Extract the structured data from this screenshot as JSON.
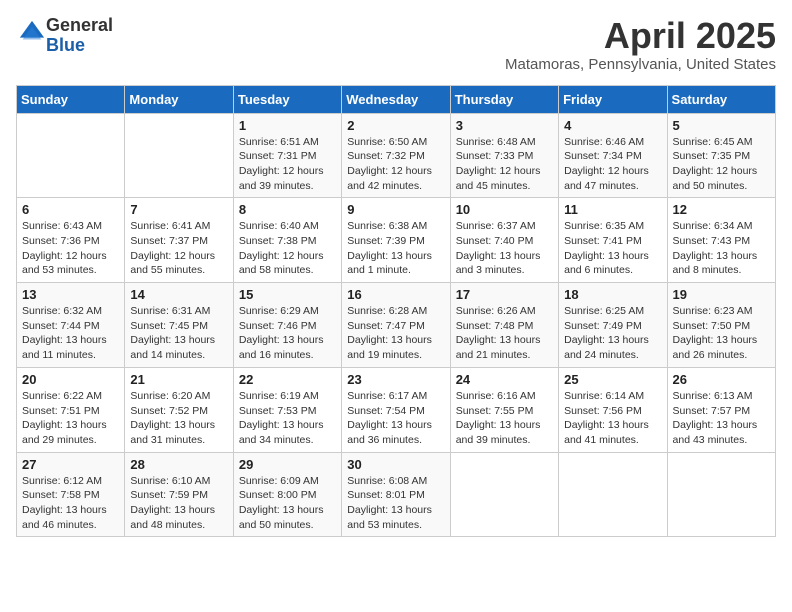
{
  "logo": {
    "general": "General",
    "blue": "Blue"
  },
  "title": "April 2025",
  "location": "Matamoras, Pennsylvania, United States",
  "days_header": [
    "Sunday",
    "Monday",
    "Tuesday",
    "Wednesday",
    "Thursday",
    "Friday",
    "Saturday"
  ],
  "weeks": [
    [
      {
        "day": "",
        "detail": ""
      },
      {
        "day": "",
        "detail": ""
      },
      {
        "day": "1",
        "detail": "Sunrise: 6:51 AM\nSunset: 7:31 PM\nDaylight: 12 hours\nand 39 minutes."
      },
      {
        "day": "2",
        "detail": "Sunrise: 6:50 AM\nSunset: 7:32 PM\nDaylight: 12 hours\nand 42 minutes."
      },
      {
        "day": "3",
        "detail": "Sunrise: 6:48 AM\nSunset: 7:33 PM\nDaylight: 12 hours\nand 45 minutes."
      },
      {
        "day": "4",
        "detail": "Sunrise: 6:46 AM\nSunset: 7:34 PM\nDaylight: 12 hours\nand 47 minutes."
      },
      {
        "day": "5",
        "detail": "Sunrise: 6:45 AM\nSunset: 7:35 PM\nDaylight: 12 hours\nand 50 minutes."
      }
    ],
    [
      {
        "day": "6",
        "detail": "Sunrise: 6:43 AM\nSunset: 7:36 PM\nDaylight: 12 hours\nand 53 minutes."
      },
      {
        "day": "7",
        "detail": "Sunrise: 6:41 AM\nSunset: 7:37 PM\nDaylight: 12 hours\nand 55 minutes."
      },
      {
        "day": "8",
        "detail": "Sunrise: 6:40 AM\nSunset: 7:38 PM\nDaylight: 12 hours\nand 58 minutes."
      },
      {
        "day": "9",
        "detail": "Sunrise: 6:38 AM\nSunset: 7:39 PM\nDaylight: 13 hours\nand 1 minute."
      },
      {
        "day": "10",
        "detail": "Sunrise: 6:37 AM\nSunset: 7:40 PM\nDaylight: 13 hours\nand 3 minutes."
      },
      {
        "day": "11",
        "detail": "Sunrise: 6:35 AM\nSunset: 7:41 PM\nDaylight: 13 hours\nand 6 minutes."
      },
      {
        "day": "12",
        "detail": "Sunrise: 6:34 AM\nSunset: 7:43 PM\nDaylight: 13 hours\nand 8 minutes."
      }
    ],
    [
      {
        "day": "13",
        "detail": "Sunrise: 6:32 AM\nSunset: 7:44 PM\nDaylight: 13 hours\nand 11 minutes."
      },
      {
        "day": "14",
        "detail": "Sunrise: 6:31 AM\nSunset: 7:45 PM\nDaylight: 13 hours\nand 14 minutes."
      },
      {
        "day": "15",
        "detail": "Sunrise: 6:29 AM\nSunset: 7:46 PM\nDaylight: 13 hours\nand 16 minutes."
      },
      {
        "day": "16",
        "detail": "Sunrise: 6:28 AM\nSunset: 7:47 PM\nDaylight: 13 hours\nand 19 minutes."
      },
      {
        "day": "17",
        "detail": "Sunrise: 6:26 AM\nSunset: 7:48 PM\nDaylight: 13 hours\nand 21 minutes."
      },
      {
        "day": "18",
        "detail": "Sunrise: 6:25 AM\nSunset: 7:49 PM\nDaylight: 13 hours\nand 24 minutes."
      },
      {
        "day": "19",
        "detail": "Sunrise: 6:23 AM\nSunset: 7:50 PM\nDaylight: 13 hours\nand 26 minutes."
      }
    ],
    [
      {
        "day": "20",
        "detail": "Sunrise: 6:22 AM\nSunset: 7:51 PM\nDaylight: 13 hours\nand 29 minutes."
      },
      {
        "day": "21",
        "detail": "Sunrise: 6:20 AM\nSunset: 7:52 PM\nDaylight: 13 hours\nand 31 minutes."
      },
      {
        "day": "22",
        "detail": "Sunrise: 6:19 AM\nSunset: 7:53 PM\nDaylight: 13 hours\nand 34 minutes."
      },
      {
        "day": "23",
        "detail": "Sunrise: 6:17 AM\nSunset: 7:54 PM\nDaylight: 13 hours\nand 36 minutes."
      },
      {
        "day": "24",
        "detail": "Sunrise: 6:16 AM\nSunset: 7:55 PM\nDaylight: 13 hours\nand 39 minutes."
      },
      {
        "day": "25",
        "detail": "Sunrise: 6:14 AM\nSunset: 7:56 PM\nDaylight: 13 hours\nand 41 minutes."
      },
      {
        "day": "26",
        "detail": "Sunrise: 6:13 AM\nSunset: 7:57 PM\nDaylight: 13 hours\nand 43 minutes."
      }
    ],
    [
      {
        "day": "27",
        "detail": "Sunrise: 6:12 AM\nSunset: 7:58 PM\nDaylight: 13 hours\nand 46 minutes."
      },
      {
        "day": "28",
        "detail": "Sunrise: 6:10 AM\nSunset: 7:59 PM\nDaylight: 13 hours\nand 48 minutes."
      },
      {
        "day": "29",
        "detail": "Sunrise: 6:09 AM\nSunset: 8:00 PM\nDaylight: 13 hours\nand 50 minutes."
      },
      {
        "day": "30",
        "detail": "Sunrise: 6:08 AM\nSunset: 8:01 PM\nDaylight: 13 hours\nand 53 minutes."
      },
      {
        "day": "",
        "detail": ""
      },
      {
        "day": "",
        "detail": ""
      },
      {
        "day": "",
        "detail": ""
      }
    ]
  ]
}
